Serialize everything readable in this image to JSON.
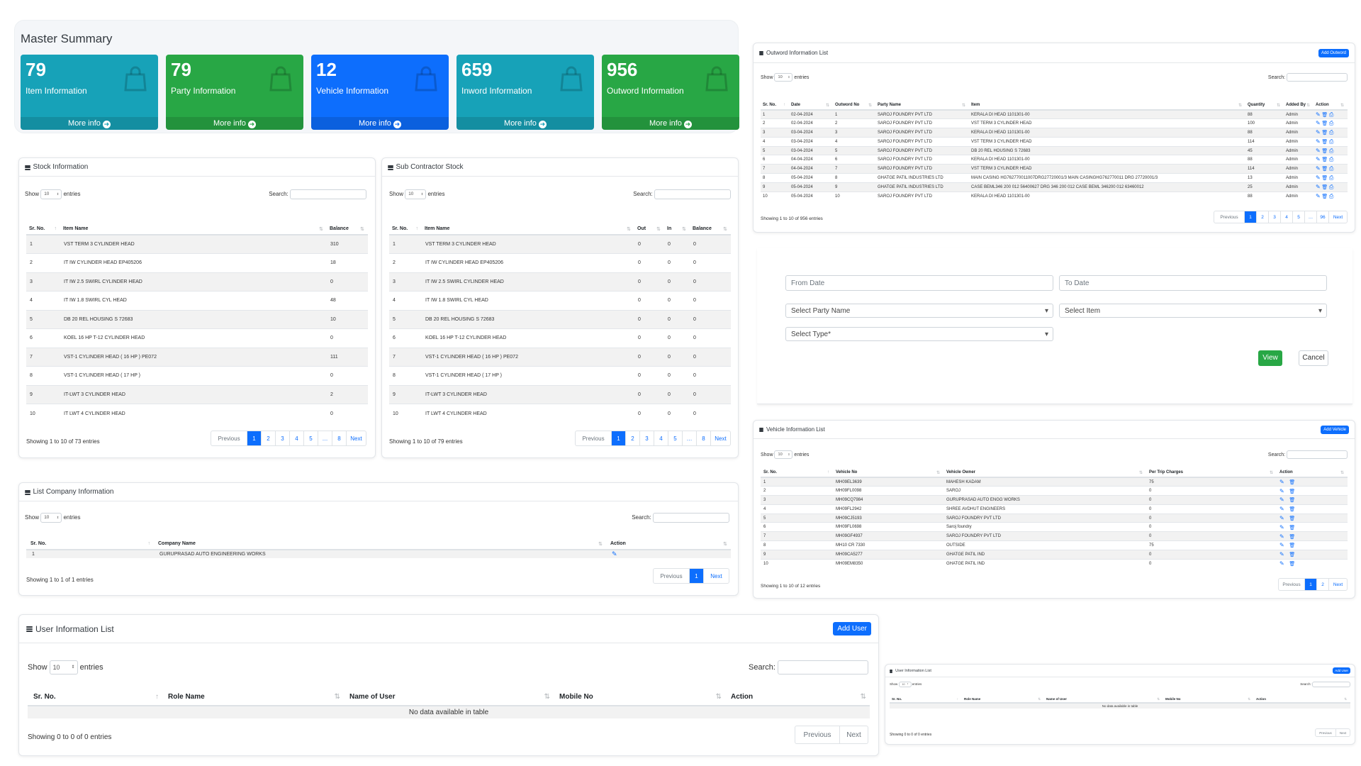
{
  "master": {
    "title": "Master Summary",
    "boxes": [
      {
        "num": "79",
        "label": "Item Information",
        "more": "More info",
        "color": "#17a2b8"
      },
      {
        "num": "79",
        "label": "Party Information",
        "more": "More info",
        "color": "#28a745"
      },
      {
        "num": "12",
        "label": "Vehicle Information",
        "more": "More info",
        "color": "#0d6efd"
      },
      {
        "num": "659",
        "label": "Inword Information",
        "more": "More info",
        "color": "#17a2b8"
      },
      {
        "num": "956",
        "label": "Outword Information",
        "more": "More info",
        "color": "#28a745"
      }
    ]
  },
  "common": {
    "show": "Show",
    "entries": "entries",
    "search": "Search:",
    "page_len": "10",
    "previous": "Previous",
    "next": "Next",
    "ellipsis": "…"
  },
  "stock": {
    "title": "Stock Information",
    "headers": [
      "Sr. No.",
      "Item Name",
      "Balance"
    ],
    "rows": [
      [
        "1",
        "VST TERM 3 CYLINDER HEAD",
        "310"
      ],
      [
        "2",
        "IT IW CYLINDER HEAD EP405206",
        "18"
      ],
      [
        "3",
        "IT IW 2.5 SWIRL CYLINDER HEAD",
        "0"
      ],
      [
        "4",
        "IT IW 1.8 SWIRL CYL HEAD",
        "48"
      ],
      [
        "5",
        "DB 20 REL HOUSING S 72683",
        "10"
      ],
      [
        "6",
        "KOEL 16 HP T-12 CYLINDER HEAD",
        "0"
      ],
      [
        "7",
        "VST-1 CYLINDER HEAD ( 16 HP ) PE072",
        "111"
      ],
      [
        "8",
        "VST-1 CYLINDER HEAD ( 17 HP )",
        "0"
      ],
      [
        "9",
        "IT-LWT 3 CYLINDER HEAD",
        "2"
      ],
      [
        "10",
        "IT LWT 4 CYLINDER HEAD",
        "0"
      ]
    ],
    "info": "Showing 1 to 10 of 73 entries",
    "pages": [
      "1",
      "2",
      "3",
      "4",
      "5",
      "…",
      "8"
    ]
  },
  "sub": {
    "title": "Sub Contractor Stock",
    "headers": [
      "Sr. No.",
      "Item Name",
      "Out",
      "In",
      "Balance"
    ],
    "rows": [
      [
        "1",
        "VST TERM 3 CYLINDER HEAD",
        "0",
        "0",
        "0"
      ],
      [
        "2",
        "IT IW CYLINDER HEAD EP405206",
        "0",
        "0",
        "0"
      ],
      [
        "3",
        "IT IW 2.5 SWIRL CYLINDER HEAD",
        "0",
        "0",
        "0"
      ],
      [
        "4",
        "IT IW 1.8 SWIRL CYL HEAD",
        "0",
        "0",
        "0"
      ],
      [
        "5",
        "DB 20 REL HOUSING S 72683",
        "0",
        "0",
        "0"
      ],
      [
        "6",
        "KOEL 16 HP T-12 CYLINDER HEAD",
        "0",
        "0",
        "0"
      ],
      [
        "7",
        "VST-1 CYLINDER HEAD ( 16 HP ) PE072",
        "0",
        "0",
        "0"
      ],
      [
        "8",
        "VST-1 CYLINDER HEAD ( 17 HP )",
        "0",
        "0",
        "0"
      ],
      [
        "9",
        "IT-LWT 3 CYLINDER HEAD",
        "0",
        "0",
        "0"
      ],
      [
        "10",
        "IT LWT 4 CYLINDER HEAD",
        "0",
        "0",
        "0"
      ]
    ],
    "info": "Showing 1 to 10 of 79 entries",
    "pages": [
      "1",
      "2",
      "3",
      "4",
      "5",
      "…",
      "8"
    ]
  },
  "company": {
    "title": "List Company Information",
    "headers": [
      "Sr. No.",
      "Company Name",
      "Action"
    ],
    "rows": [
      [
        "1",
        "GURUPRASAD AUTO ENGINEERING WORKS"
      ]
    ],
    "info": "Showing 1 to 1 of 1 entries",
    "pages": [
      "1"
    ]
  },
  "user": {
    "title": "User Information List",
    "add": "Add User",
    "headers": [
      "Sr. No.",
      "Role Name",
      "Name of User",
      "Mobile No",
      "Action"
    ],
    "empty": "No data available in table",
    "info": "Showing 0 to 0 of 0 entries"
  },
  "outword": {
    "title": "Outword Information List",
    "add": "Add Outword",
    "headers": [
      "Sr. No.",
      "Date",
      "Outword No",
      "Party Name",
      "Item",
      "Quantity",
      "Added By",
      "Action"
    ],
    "rows": [
      [
        "1",
        "02-04-2024",
        "1",
        "SAROJ FOUNDRY PVT LTD",
        "KERALA DI HEAD 1101301-00",
        "88",
        "Admin"
      ],
      [
        "2",
        "02-04-2024",
        "2",
        "SAROJ FOUNDRY PVT LTD",
        "VST TERM 3 CYLINDER HEAD",
        "100",
        "Admin"
      ],
      [
        "3",
        "03-04-2024",
        "3",
        "SAROJ FOUNDRY PVT LTD",
        "KERALA DI HEAD 1101301-00",
        "88",
        "Admin"
      ],
      [
        "4",
        "03-04-2024",
        "4",
        "SAROJ FOUNDRY PVT LTD",
        "VST TERM 3 CYLINDER HEAD",
        "114",
        "Admin"
      ],
      [
        "5",
        "03-04-2024",
        "5",
        "SAROJ FOUNDRY PVT LTD",
        "DB 20 REL HOUSING S 72683",
        "45",
        "Admin"
      ],
      [
        "6",
        "04-04-2024",
        "6",
        "SAROJ FOUNDRY PVT LTD",
        "KERALA DI HEAD 1101301-00",
        "88",
        "Admin"
      ],
      [
        "7",
        "04-04-2024",
        "7",
        "SAROJ FOUNDRY PVT LTD",
        "VST TERM 3 CYLINDER HEAD",
        "114",
        "Admin"
      ],
      [
        "8",
        "05-04-2024",
        "8",
        "GHATGE PATIL INDUSTRIES LTD",
        "MAIN CASING HG762770011007DRG27720001/3 MAIN CASINGHG762770011 DRG 27720001/3",
        "13",
        "Admin"
      ],
      [
        "9",
        "05-04-2024",
        "9",
        "GHATGE PATIL INDUSTRIES LTD",
        "CASE BEML346 200 012 56400627 DRG 346 200 012 CASE BEML 346200 012 63460012",
        "25",
        "Admin"
      ],
      [
        "10",
        "05-04-2024",
        "10",
        "SAROJ FOUNDRY PVT LTD",
        "KERALA DI HEAD 1101301-00",
        "88",
        "Admin"
      ]
    ],
    "info": "Showing 1 to 10 of 956 entries",
    "pages": [
      "1",
      "2",
      "3",
      "4",
      "5",
      "…",
      "96"
    ]
  },
  "filter": {
    "from": "From Date",
    "to": "To Date",
    "party": "Select Party Name",
    "item": "Select Item",
    "type": "Select Type*",
    "view": "View",
    "cancel": "Cancel"
  },
  "vehicle": {
    "title": "Vehicle Information List",
    "add": "Add Vehicle",
    "headers": [
      "Sr. No.",
      "Vehicle No",
      "Vehicle Owner",
      "Per Trip Charges",
      "Action"
    ],
    "rows": [
      [
        "1",
        "MH09EL3639",
        "MAHESH KADAM",
        "75"
      ],
      [
        "2",
        "MH09FL0098",
        "SAROJ",
        "0"
      ],
      [
        "3",
        "MH09CQ7984",
        "GURUPRASAD AUTO ENGG WORKS",
        "0"
      ],
      [
        "4",
        "MH09FL2942",
        "SHREE AVDHUT ENGINEERS",
        "0"
      ],
      [
        "5",
        "MH09CJ5193",
        "SAROJ FOUNDRY PVT LTD",
        "0"
      ],
      [
        "6",
        "MH09FL0698",
        "Saroj foundry",
        "0"
      ],
      [
        "7",
        "MH09GF4937",
        "SAROJ FOUNDRY PVT LTD",
        "0"
      ],
      [
        "8",
        "MH10 CR 7330",
        "OUTSIDE",
        "75"
      ],
      [
        "9",
        "MH09CA5277",
        "GHATGE PATIL IND",
        "0"
      ],
      [
        "10",
        "MH09EM8350",
        "GHATGE PATIL IND",
        "0"
      ]
    ],
    "info": "Showing 1 to 10 of 12 entries",
    "pages": [
      "1",
      "2"
    ]
  },
  "user_small": {
    "title": "User Information List",
    "add": "Add User",
    "headers": [
      "Sr. No.",
      "Role Name",
      "Name of User",
      "Mobile No",
      "Action"
    ],
    "empty": "No data available in table",
    "info": "Showing 0 to 0 of 0 entries"
  }
}
